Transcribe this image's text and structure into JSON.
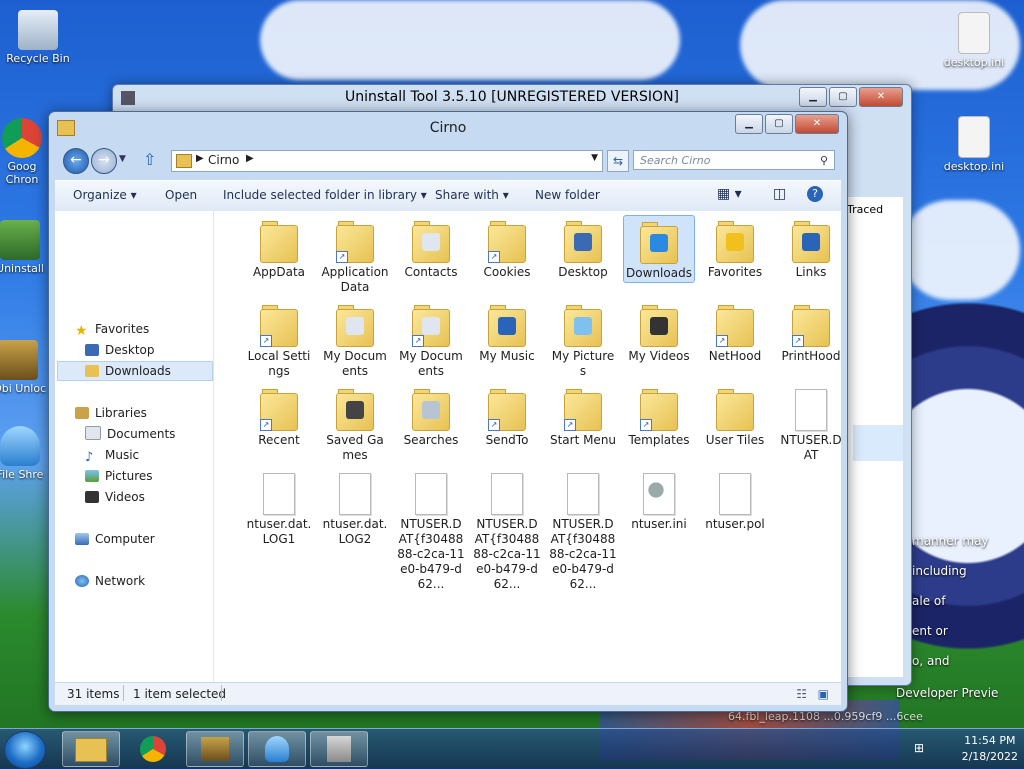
{
  "desktop": {
    "icons_left": [
      "Recycle Bin",
      "Goog Chron",
      "Uninstall",
      "IObi Unloc",
      "File Shre"
    ],
    "icons_right": [
      "desktop.ini",
      "desktop.ini"
    ],
    "bg_text_lines": [
      "manner may",
      "including",
      "ale of",
      "ent or",
      "o, and"
    ],
    "bg_footer1": "Developer Previe",
    "bg_footer2": "64.fbl_leap.1108 ...0.959cf9 ...6cee"
  },
  "bg_window": {
    "title": "Uninstall Tool 3.5.10 [UNREGISTERED VERSION]",
    "column": "Traced"
  },
  "explorer": {
    "title": "Cirno",
    "address_path": "Cirno",
    "search_placeholder": "Search Cirno",
    "toolbar": {
      "organize": "Organize",
      "open": "Open",
      "include_library": "Include selected folder in library",
      "share_with": "Share with",
      "new_folder": "New folder"
    },
    "nav": {
      "favorites": "Favorites",
      "desktop": "Desktop",
      "downloads": "Downloads",
      "libraries": "Libraries",
      "documents": "Documents",
      "music": "Music",
      "pictures": "Pictures",
      "videos": "Videos",
      "computer": "Computer",
      "network": "Network"
    },
    "items": [
      {
        "name": "AppData",
        "kind": "folder"
      },
      {
        "name": "Application Data",
        "kind": "folder-shortcut"
      },
      {
        "name": "Contacts",
        "kind": "folder"
      },
      {
        "name": "Cookies",
        "kind": "folder-shortcut"
      },
      {
        "name": "Desktop",
        "kind": "folder"
      },
      {
        "name": "Downloads",
        "kind": "folder",
        "selected": true
      },
      {
        "name": "Favorites",
        "kind": "folder"
      },
      {
        "name": "Links",
        "kind": "folder"
      },
      {
        "name": "Local Settings",
        "kind": "folder-shortcut"
      },
      {
        "name": "My Documents",
        "kind": "folder"
      },
      {
        "name": "My Documents",
        "kind": "folder-shortcut"
      },
      {
        "name": "My Music",
        "kind": "folder"
      },
      {
        "name": "My Pictures",
        "kind": "folder"
      },
      {
        "name": "My Videos",
        "kind": "folder"
      },
      {
        "name": "NetHood",
        "kind": "folder-shortcut"
      },
      {
        "name": "PrintHood",
        "kind": "folder-shortcut"
      },
      {
        "name": "Recent",
        "kind": "folder-shortcut"
      },
      {
        "name": "Saved Games",
        "kind": "folder"
      },
      {
        "name": "Searches",
        "kind": "folder"
      },
      {
        "name": "SendTo",
        "kind": "folder-shortcut"
      },
      {
        "name": "Start Menu",
        "kind": "folder-shortcut"
      },
      {
        "name": "Templates",
        "kind": "folder-shortcut"
      },
      {
        "name": "User Tiles",
        "kind": "folder"
      },
      {
        "name": "NTUSER.DAT",
        "kind": "file"
      },
      {
        "name": "ntuser.dat.LOG1",
        "kind": "file"
      },
      {
        "name": "ntuser.dat.LOG2",
        "kind": "file"
      },
      {
        "name": "NTUSER.DAT{f3048888-c2ca-11e0-b479-d62...",
        "kind": "file"
      },
      {
        "name": "NTUSER.DAT{f3048888-c2ca-11e0-b479-d62...",
        "kind": "file"
      },
      {
        "name": "NTUSER.DAT{f3048888-c2ca-11e0-b479-d62...",
        "kind": "file"
      },
      {
        "name": "ntuser.ini",
        "kind": "file-gear"
      },
      {
        "name": "ntuser.pol",
        "kind": "file"
      }
    ],
    "status": {
      "count": "31 items",
      "selected": "1 item selected"
    }
  },
  "taskbar": {
    "time": "11:54 PM",
    "date": "2/18/2022"
  },
  "colors": {
    "accent": "#cfe3fb",
    "folder": "#f3d573"
  }
}
